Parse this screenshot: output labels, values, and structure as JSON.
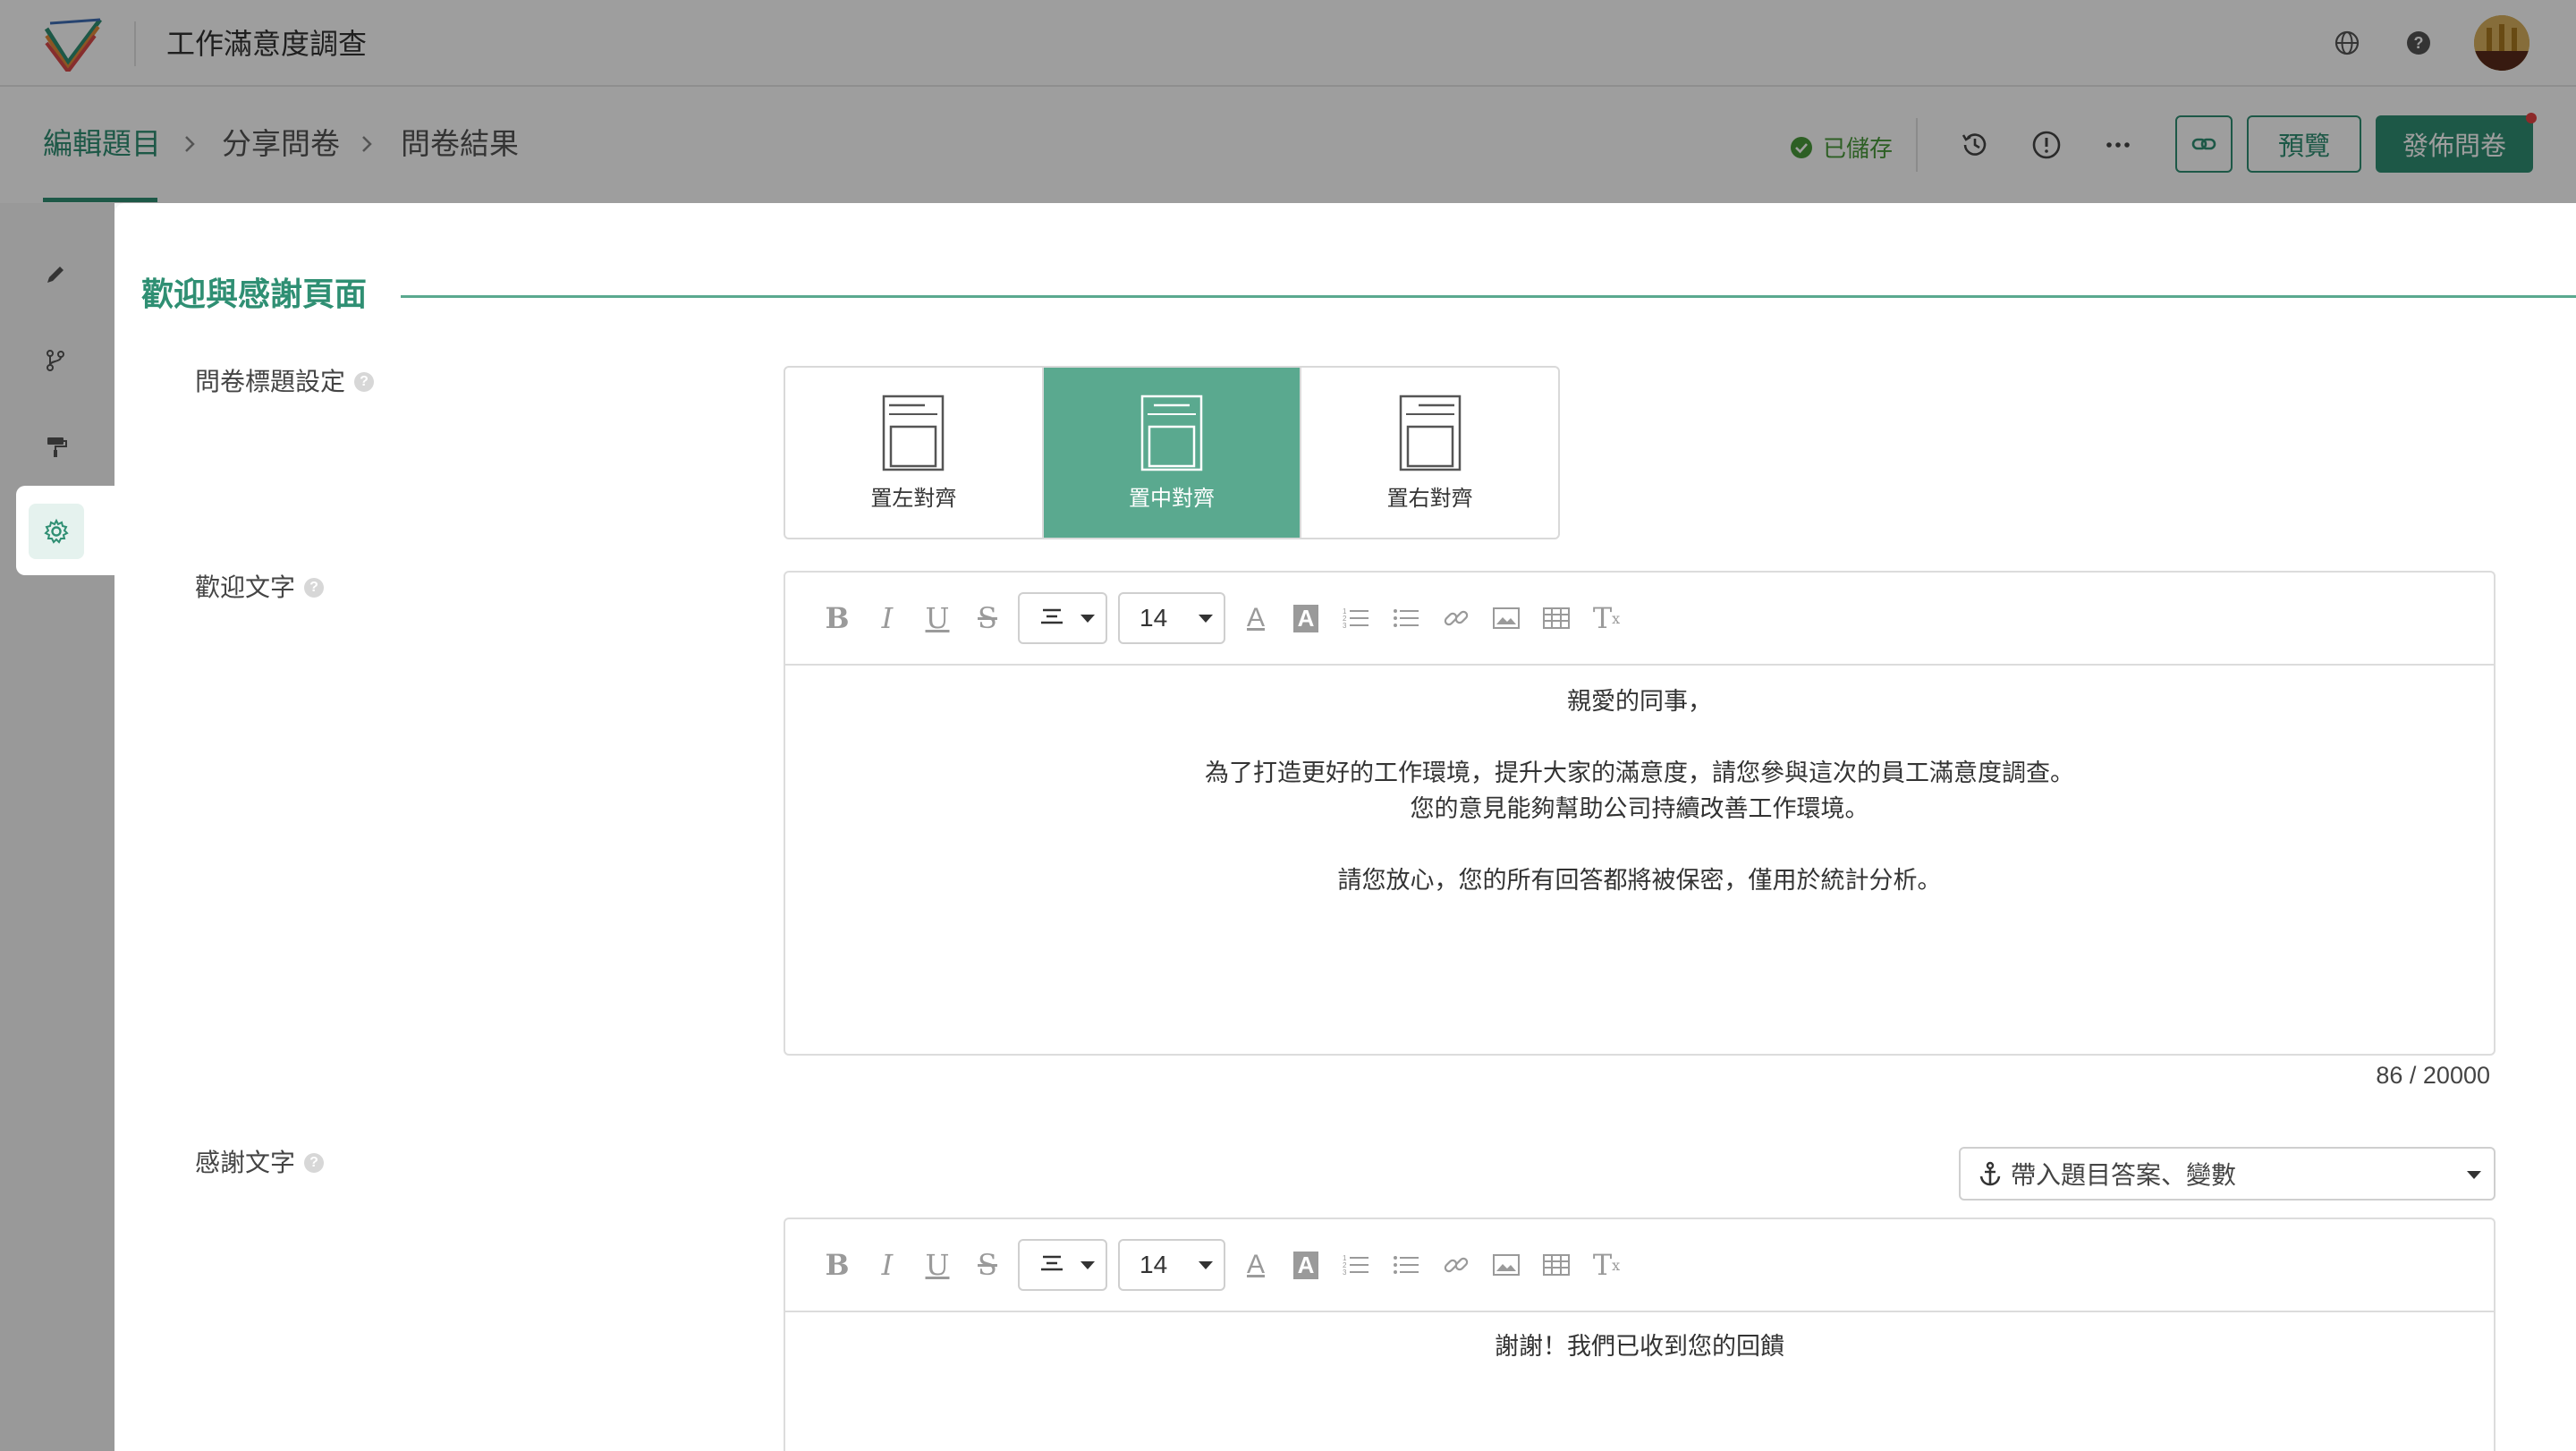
{
  "header": {
    "app_title": "工作滿意度調查",
    "icons": [
      "globe-icon",
      "help-icon",
      "avatar"
    ]
  },
  "steps": [
    {
      "label": "編輯題目",
      "active": true
    },
    {
      "label": "分享問卷",
      "active": false
    },
    {
      "label": "問卷結果",
      "active": false
    }
  ],
  "status": {
    "saved_label": "已儲存"
  },
  "actions": {
    "preview_label": "預覽",
    "publish_label": "發佈問卷"
  },
  "section": {
    "title": "歡迎與感謝頁面"
  },
  "title_setting": {
    "label": "問卷標題設定",
    "options": [
      {
        "label": "置左對齊",
        "selected": false
      },
      {
        "label": "置中對齊",
        "selected": true
      },
      {
        "label": "置右對齊",
        "selected": false
      }
    ]
  },
  "welcome": {
    "label": "歡迎文字",
    "font_size": "14",
    "lines": [
      "親愛的同事，",
      "",
      "為了打造更好的工作環境，提升大家的滿意度，請您參與這次的員工滿意度調查。",
      "您的意見能夠幫助公司持續改善工作環境。",
      "",
      "請您放心，您的所有回答都將被保密，僅用於統計分析。"
    ],
    "counter": "86 / 20000"
  },
  "thanks": {
    "label": "感謝文字",
    "variable_select": "帶入題目答案、變數",
    "font_size": "14",
    "lines": [
      "謝謝！我們已收到您的回饋"
    ]
  },
  "colors": {
    "accent": "#2f8f73",
    "accent_light": "#5aa98f",
    "saved": "#4a9a3a"
  }
}
